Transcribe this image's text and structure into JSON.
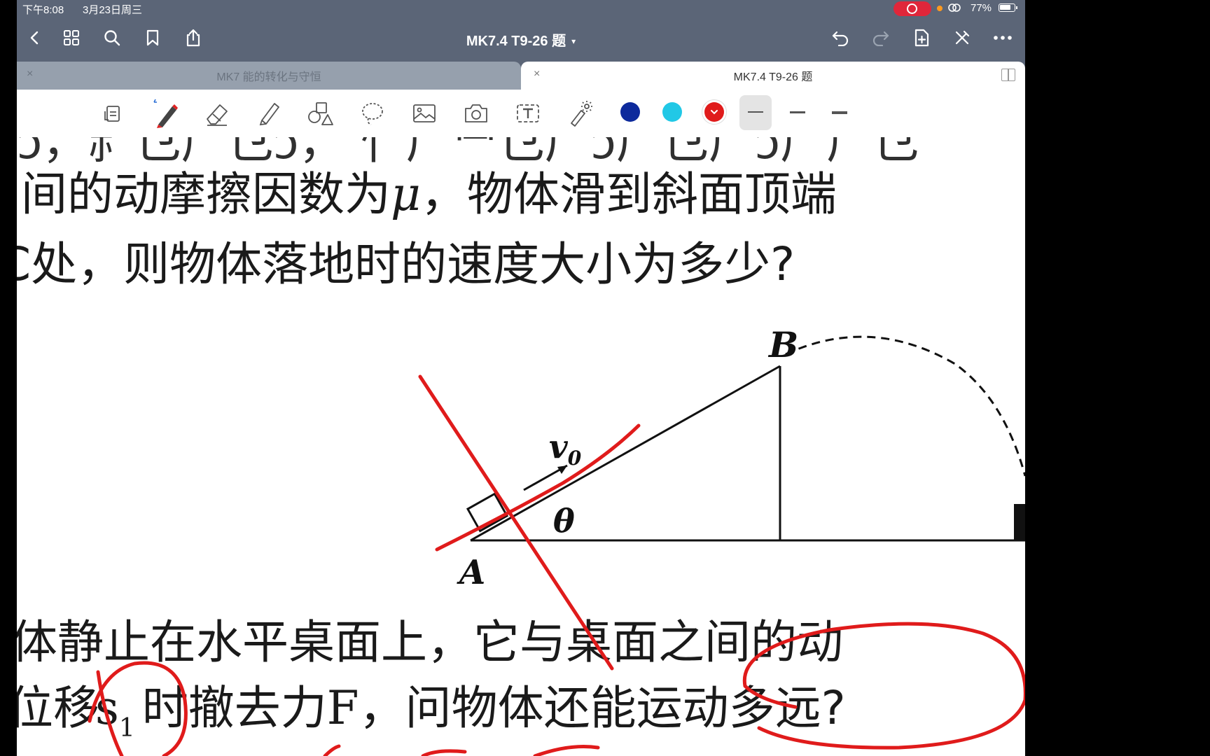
{
  "status_bar": {
    "time": "下午8:08",
    "date": "3月23日周三",
    "battery": "77%"
  },
  "nav": {
    "title": "MK7.4 T9-26 题",
    "title_chevron": "⌄"
  },
  "tabs": [
    {
      "label": "MK7 能的转化与守恒",
      "close": "×",
      "active": false
    },
    {
      "label": "MK7.4 T9-26 题",
      "close": "×",
      "active": true
    }
  ],
  "toolbar": {
    "tools": [
      "page-icon",
      "pen-icon",
      "eraser-icon",
      "highlighter-icon",
      "shapes-icon",
      "lasso-icon",
      "image-icon",
      "camera-icon",
      "text-icon",
      "laser-pointer-icon"
    ],
    "colors": [
      "#0d2a9c",
      "#21c8e6",
      "#e01b1b"
    ],
    "selected_color": "#e01b1b",
    "widths": [
      "thin",
      "medium",
      "thick"
    ],
    "selected_width": "thin"
  },
  "content": {
    "line1_text": "间的动摩擦因数为",
    "line1_symbol": "μ",
    "line1_tail": "，物体滑到斜面顶端",
    "line2_text": "C处，则物体落地时的速度大小为多少?",
    "line3_text": "体静止在水平桌面上，它与桌面之间的动",
    "line4_head": "位移",
    "line4_s": "s",
    "line4_sub": "1",
    "line4_mid": "时撤去力",
    "line4_F": "F",
    "line4_tail": "，问物体还能运动多远?"
  },
  "figure": {
    "label_A": "A",
    "label_B": "B",
    "label_theta": "θ",
    "label_v": "v",
    "label_v_sub": "0"
  }
}
